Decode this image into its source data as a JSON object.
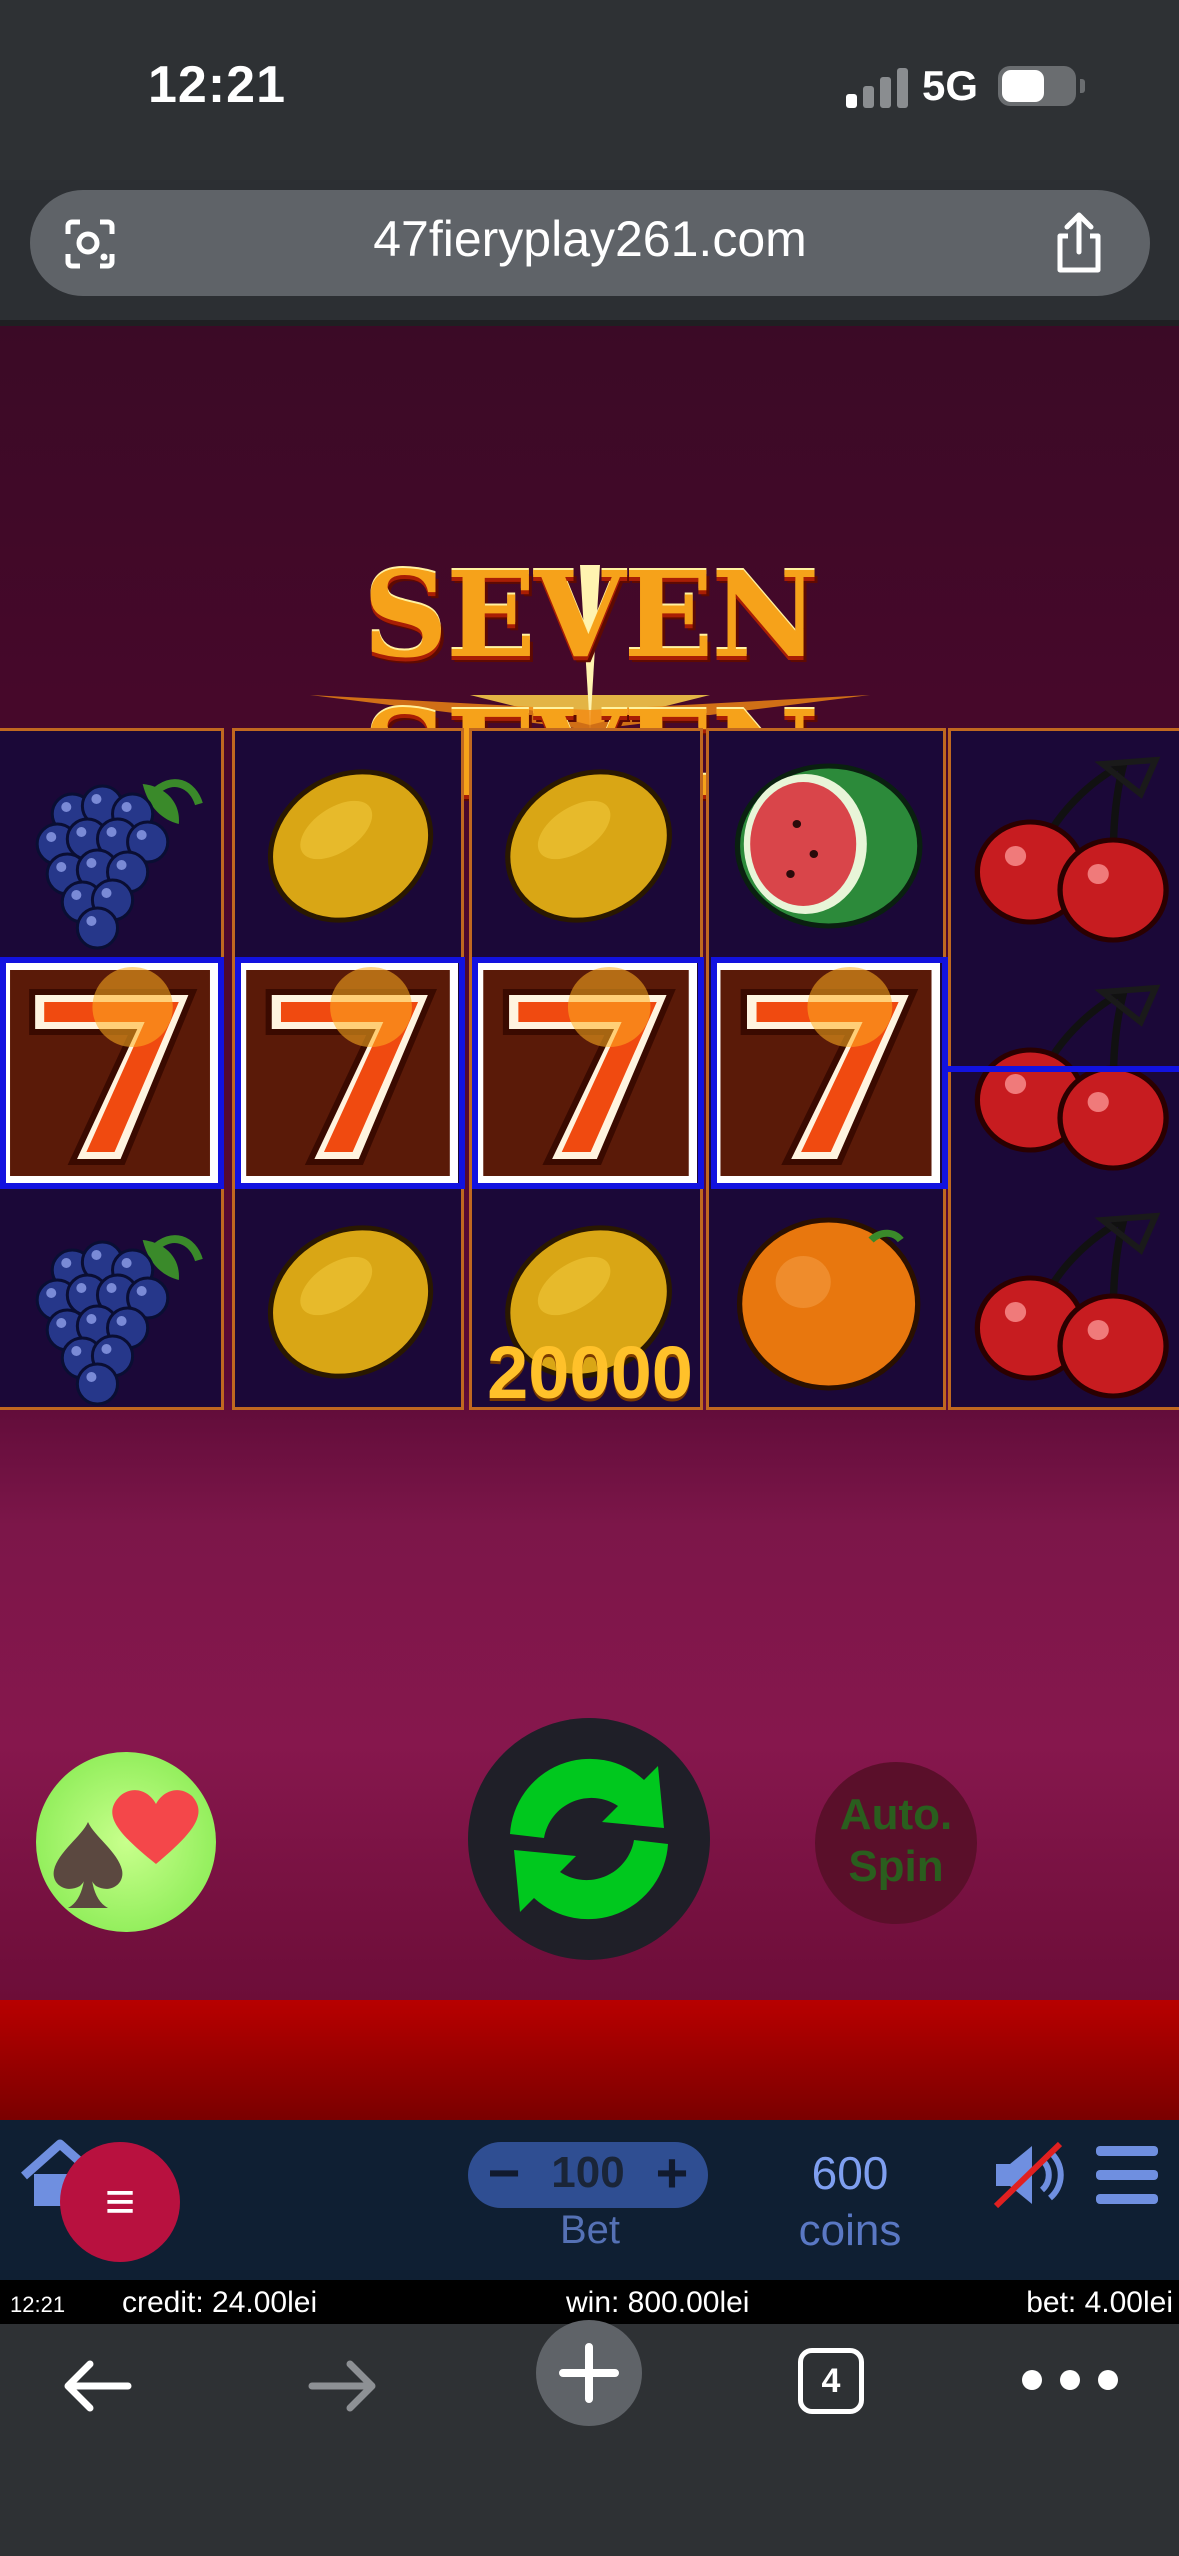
{
  "status_bar": {
    "time": "12:21",
    "network": "5G"
  },
  "browser": {
    "url": "47fieryplay261.com",
    "tab_count": "4"
  },
  "game": {
    "title": "SEVEN SEVEN",
    "win_amount": "20000",
    "reels": [
      [
        "grapes-icon",
        "seven-icon",
        "grapes-icon"
      ],
      [
        "lemon-icon",
        "seven-icon",
        "lemon-icon"
      ],
      [
        "lemon-icon",
        "seven-icon",
        "lemon-icon"
      ],
      [
        "watermelon-icon",
        "seven-icon",
        "orange-icon"
      ],
      [
        "cherries-icon",
        "cherries-icon",
        "cherries-icon"
      ]
    ],
    "auto_spin_line1": "Auto.",
    "auto_spin_line2": "Spin",
    "spin_color": "#00c81e"
  },
  "controls": {
    "bet_value": "100",
    "bet_label": "Bet",
    "coins_value": "600",
    "coins_label": "coins",
    "menu_glyph": "≡",
    "minus_glyph": "−",
    "plus_glyph": "+"
  },
  "info_strip": {
    "time": "12:21",
    "credit": "credit: 24.00lei",
    "win": "win: 800.00lei",
    "bet": "bet: 4.00lei"
  }
}
